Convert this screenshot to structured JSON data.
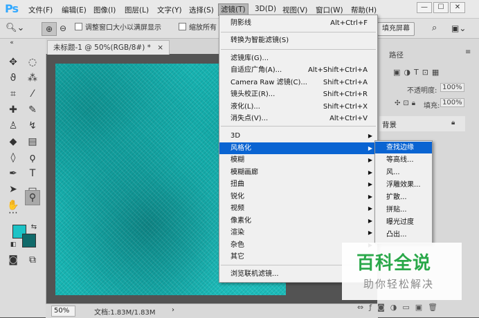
{
  "app": {
    "logo": "Ps"
  },
  "menubar": {
    "items": [
      "文件(F)",
      "编辑(E)",
      "图像(I)",
      "图层(L)",
      "文字(Y)",
      "选择(S)",
      "滤镜(T)",
      "3D(D)",
      "视图(V)",
      "窗口(W)",
      "帮助(H)"
    ],
    "window_controls": [
      "—",
      "☐",
      "✕"
    ]
  },
  "options_bar": {
    "resize_window_label": "调整窗口大小以满屏显示",
    "zoom_all_label": "缩放所有",
    "fill_screen_label": "填充屏幕"
  },
  "document": {
    "tab_title": "未标题-1 @ 50%(RGB/8#) *",
    "tab_close": "×",
    "zoom": "50%",
    "doc_info": "文档:1.83M/1.83M",
    "canvas_color": "#18b5b3"
  },
  "colors": {
    "foreground": "#1cc3c6",
    "background": "#106a6a",
    "menu_highlight": "#0a64d2"
  },
  "panels": {
    "tab_paths": "路径",
    "opacity_label": "不透明度:",
    "opacity_value": "100%",
    "fill_label": "填充:",
    "fill_value": "100%",
    "layer_name": "背景"
  },
  "filter_menu": {
    "items": [
      {
        "label": "阴影线",
        "shortcut": "Alt+Ctrl+F"
      },
      {
        "label": "转换为智能滤镜(S)",
        "shortcut": ""
      },
      {
        "label": "滤镜库(G)...",
        "shortcut": ""
      },
      {
        "label": "自适应广角(A)...",
        "shortcut": "Alt+Shift+Ctrl+A"
      },
      {
        "label": "Camera Raw 滤镜(C)...",
        "shortcut": "Shift+Ctrl+A"
      },
      {
        "label": "镜头校正(R)...",
        "shortcut": "Shift+Ctrl+R"
      },
      {
        "label": "液化(L)...",
        "shortcut": "Shift+Ctrl+X"
      },
      {
        "label": "消失点(V)...",
        "shortcut": "Alt+Ctrl+V"
      },
      {
        "label": "3D",
        "shortcut": ""
      },
      {
        "label": "风格化",
        "shortcut": ""
      },
      {
        "label": "模糊",
        "shortcut": ""
      },
      {
        "label": "模糊画廊",
        "shortcut": ""
      },
      {
        "label": "扭曲",
        "shortcut": ""
      },
      {
        "label": "锐化",
        "shortcut": ""
      },
      {
        "label": "视频",
        "shortcut": ""
      },
      {
        "label": "像素化",
        "shortcut": ""
      },
      {
        "label": "渲染",
        "shortcut": ""
      },
      {
        "label": "杂色",
        "shortcut": ""
      },
      {
        "label": "其它",
        "shortcut": ""
      },
      {
        "label": "浏览联机滤镜...",
        "shortcut": ""
      }
    ]
  },
  "stylize_submenu": {
    "items": [
      "查找边缘",
      "等高线...",
      "风...",
      "浮雕效果...",
      "扩散...",
      "拼贴...",
      "曝光过度",
      "凸出..."
    ]
  },
  "watermark": {
    "main": "百科全说",
    "sub": "助你轻松解决"
  }
}
